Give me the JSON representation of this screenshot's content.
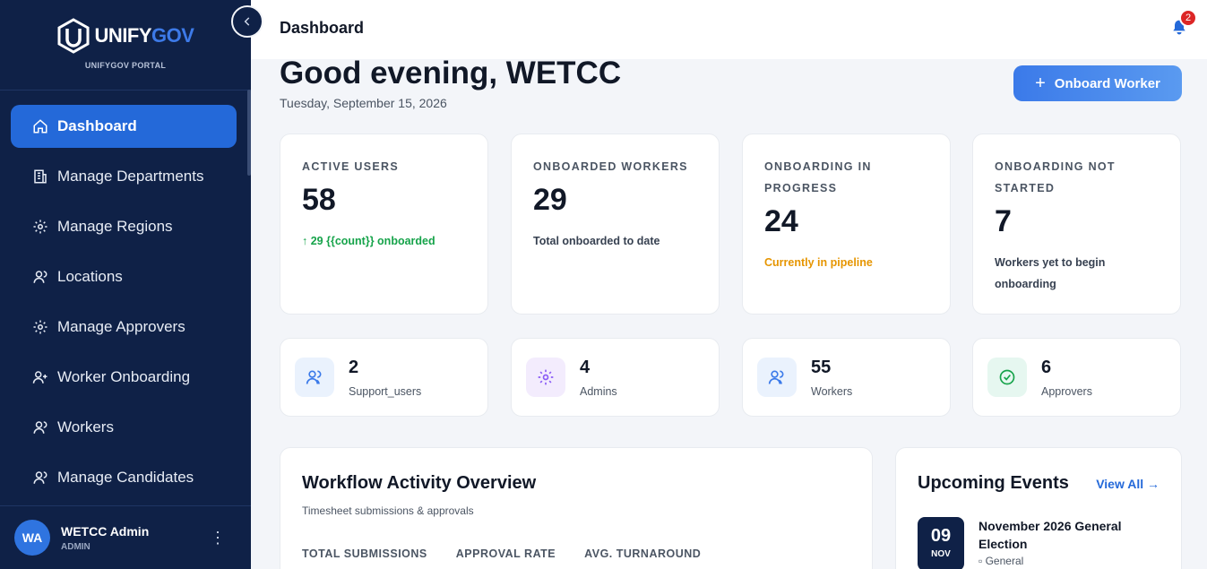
{
  "brand": {
    "name_part1": "UNIFY",
    "name_part2": "GOV",
    "subtitle": "UNIFYGOV PORTAL"
  },
  "sidebar": {
    "items": [
      {
        "label": "Dashboard",
        "icon": "home-icon"
      },
      {
        "label": "Manage Departments",
        "icon": "building-icon"
      },
      {
        "label": "Manage Regions",
        "icon": "gear-icon"
      },
      {
        "label": "Locations",
        "icon": "user-icon"
      },
      {
        "label": "Manage Approvers",
        "icon": "gear-icon"
      },
      {
        "label": "Worker Onboarding",
        "icon": "user-plus-icon"
      },
      {
        "label": "Workers",
        "icon": "user-icon"
      },
      {
        "label": "Manage Candidates",
        "icon": "user-icon"
      }
    ],
    "active_index": 0
  },
  "user": {
    "initials": "WA",
    "name": "WETCC Admin",
    "role": "ADMIN"
  },
  "topbar": {
    "title": "Dashboard",
    "notification_count": "2"
  },
  "header": {
    "greeting": "Good evening, WETCC",
    "date": "Tuesday, September 15, 2026",
    "onboard_label": "Onboard Worker"
  },
  "stats": [
    {
      "label": "ACTIVE USERS",
      "value": "58",
      "note": "↑ 29 {{count}} onboarded",
      "note_color": "#16a34a"
    },
    {
      "label": "ONBOARDED WORKERS",
      "value": "29",
      "note": "Total onboarded to date",
      "note_color": "#374151"
    },
    {
      "label": "ONBOARDING IN PROGRESS",
      "value": "24",
      "note": "Currently in pipeline",
      "note_color": "#e69500"
    },
    {
      "label": "ONBOARDING NOT STARTED",
      "value": "7",
      "note": "Workers yet to begin onboarding",
      "note_color": "#374151"
    }
  ],
  "minis": [
    {
      "value": "2",
      "label": "Support_users",
      "icon": "users-icon",
      "bg": "#eaf2fd",
      "color": "#3b7ae9"
    },
    {
      "value": "4",
      "label": "Admins",
      "icon": "gear-icon",
      "bg": "#f3ecfd",
      "color": "#8b5cf6"
    },
    {
      "value": "55",
      "label": "Workers",
      "icon": "users-icon",
      "bg": "#eaf2fd",
      "color": "#3b7ae9"
    },
    {
      "value": "6",
      "label": "Approvers",
      "icon": "check-circle-icon",
      "bg": "#e6f7f0",
      "color": "#16a34a"
    }
  ],
  "workflow": {
    "title": "Workflow Activity Overview",
    "subtitle": "Timesheet submissions & approvals",
    "metrics": [
      "TOTAL SUBMISSIONS",
      "APPROVAL RATE",
      "AVG. TURNAROUND"
    ]
  },
  "events": {
    "title": "Upcoming Events",
    "view_all": "View All →",
    "items": [
      {
        "day": "09",
        "month": "NOV",
        "name": "November 2026 General Election",
        "category": "General"
      }
    ]
  }
}
